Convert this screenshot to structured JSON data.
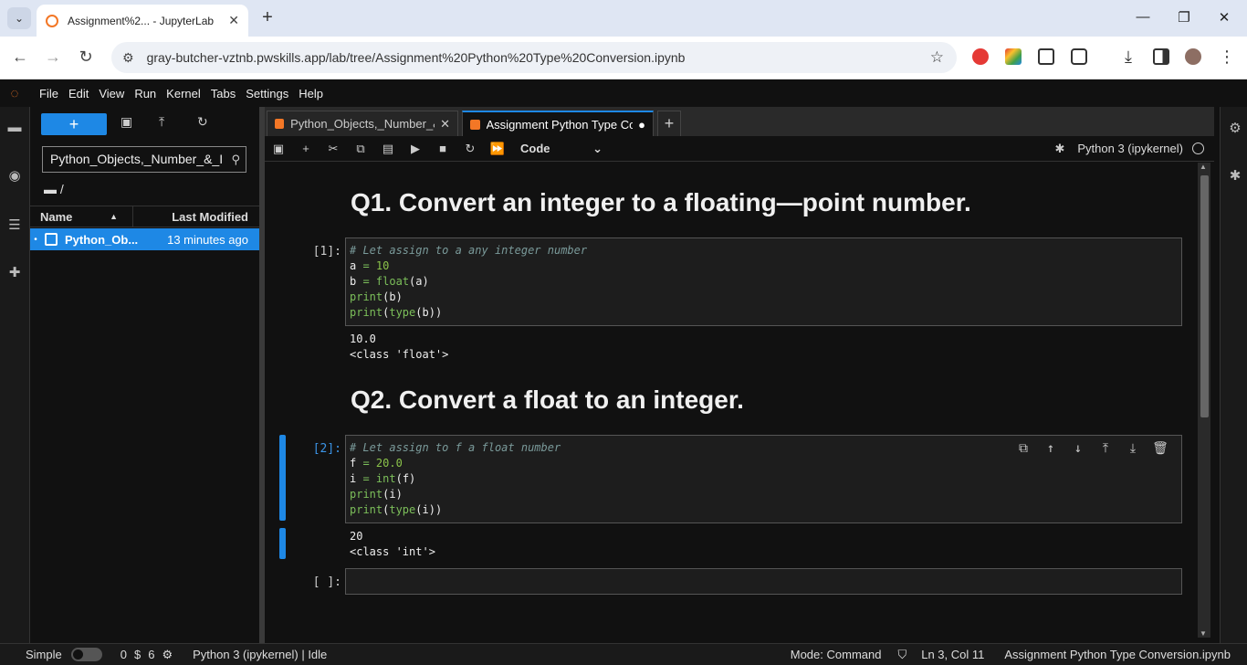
{
  "browser": {
    "tab_title": "Assignment%2... - JupyterLab",
    "new_tab": "+",
    "url": "gray-butcher-vztnb.pwskills.app/lab/tree/Assignment%20Python%20Type%20Conversion.ipynb"
  },
  "menu": [
    "File",
    "Edit",
    "View",
    "Run",
    "Kernel",
    "Tabs",
    "Settings",
    "Help"
  ],
  "file_browser": {
    "new_label": "+",
    "search_value": "Python_Objects,_Number_&_I",
    "breadcrumb": "/",
    "col_name": "Name",
    "col_modified": "Last Modified",
    "file_name": "Python_Ob...",
    "file_modified": "13 minutes ago"
  },
  "dock": {
    "tab1": "Python_Objects,_Number_&_",
    "tab2": "Assignment Python Type Cor",
    "add": "+"
  },
  "toolbar": {
    "cell_type": "Code",
    "kernel_name": "Python 3 (ipykernel)"
  },
  "notebook": {
    "q1_heading": "Q1. Convert an integer to a floating—point number.",
    "q1_prompt": "[1]:",
    "q1_code": {
      "comment": "# Let assign to a any integer number",
      "l2a": "a",
      "l2b": " = ",
      "l2c": "10",
      "l3a": "b",
      "l3b": " = ",
      "l3c": "float",
      "l3d": "(a)",
      "l4a": "print",
      "l4b": "(b)",
      "l5a": "print",
      "l5b": "(",
      "l5c": "type",
      "l5d": "(b))"
    },
    "q1_output": [
      "10.0",
      "<class 'float'>"
    ],
    "q2_heading": "Q2. Convert a float to an integer.",
    "q2_prompt": "[2]:",
    "q2_code": {
      "comment": "# Let assign to f a float number",
      "l2a": "f",
      "l2b": " = ",
      "l2c": "20.0",
      "l3a": "i",
      "l3b": " = ",
      "l3c": "int",
      "l3d": "(f)",
      "l4a": "print",
      "l4b": "(i)",
      "l5a": "print",
      "l5b": "(",
      "l5c": "type",
      "l5d": "(i))"
    },
    "q2_output": [
      "20",
      "<class 'int'>"
    ],
    "empty_prompt": "[ ]:"
  },
  "status": {
    "mode_label": "Simple",
    "terminals": "0",
    "kernels": "6",
    "kernel_status": "Python 3 (ipykernel) | Idle",
    "mode": "Mode: Command",
    "cursor": "Ln 3, Col 11",
    "filename": "Assignment Python Type Conversion.ipynb"
  },
  "colors": {
    "accent": "#1e88e5",
    "jupyter_orange": "#f37726"
  }
}
